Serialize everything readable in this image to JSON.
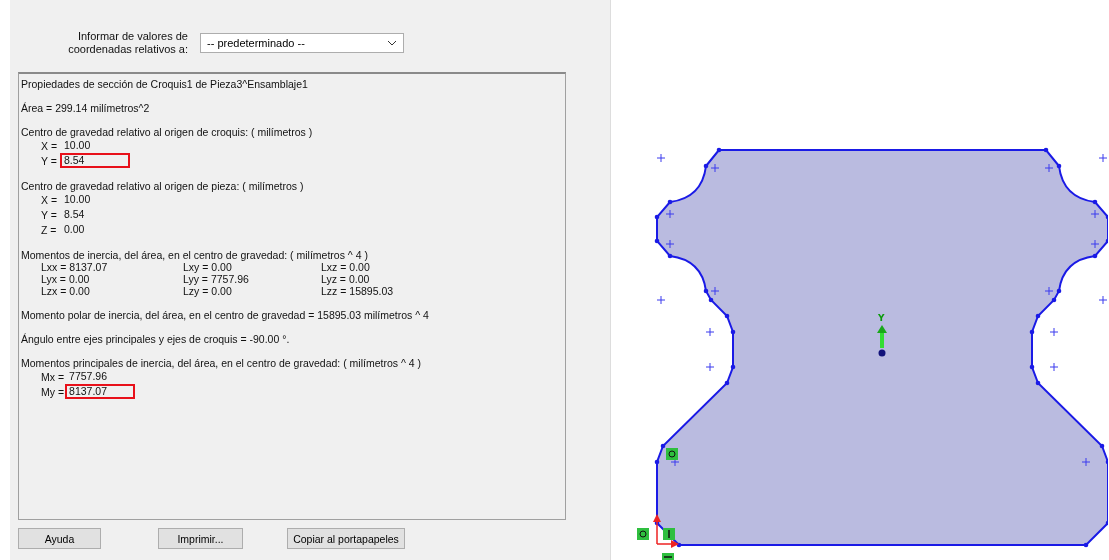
{
  "report_relative_to": {
    "label": "Informar de valores de coordenadas relativos a:",
    "value": "-- predeterminado --"
  },
  "report": {
    "title": "Propiedades de sección de Croquis1 de Pieza3^Ensamblaje1",
    "sections": [
      {
        "heading": "Área = 299.14 milímetros^2"
      },
      {
        "heading": "Centro de gravedad relativo al origen de croquis: ( milímetros )",
        "items": [
          {
            "label": "X =",
            "value": "10.00",
            "highlighted": false
          },
          {
            "label": "Y =",
            "value": "8.54",
            "highlighted": true
          }
        ]
      },
      {
        "heading": "Centro de gravedad relativo al origen de pieza: ( milímetros )",
        "items": [
          {
            "label": "X =",
            "value": "10.00",
            "highlighted": false
          },
          {
            "label": "Y =",
            "value": "8.54",
            "highlighted": false
          },
          {
            "label": "Z =",
            "value": "0.00",
            "highlighted": false
          }
        ]
      },
      {
        "heading": "Momentos de inercia, del área, en el centro de gravedad: ( milímetros ^ 4 )",
        "grid": [
          [
            "Lxx = 8137.07",
            "Lxy = 0.00",
            "Lxz = 0.00"
          ],
          [
            "Lyx = 0.00",
            "Lyy = 7757.96",
            "Lyz = 0.00"
          ],
          [
            "Lzx = 0.00",
            "Lzy = 0.00",
            "Lzz = 15895.03"
          ]
        ]
      },
      {
        "heading": "Momento polar de inercia, del área, en el centro de gravedad = 15895.03 milímetros ^ 4"
      },
      {
        "heading": "Ángulo entre ejes principales y ejes de croquis = -90.00 °."
      },
      {
        "heading": "Momentos principales de inercia, del área, en el centro de gravedad: ( milímetros ^ 4 )",
        "items": [
          {
            "label": "Mx =",
            "value": "7757.96",
            "highlighted": false
          },
          {
            "label": "My =",
            "value": "8137.07",
            "highlighted": true
          }
        ]
      }
    ]
  },
  "buttons": [
    "Ayuda",
    "Imprimir...",
    "Copiar al portapapeles"
  ],
  "sketch": {
    "axis_label": "Y"
  }
}
